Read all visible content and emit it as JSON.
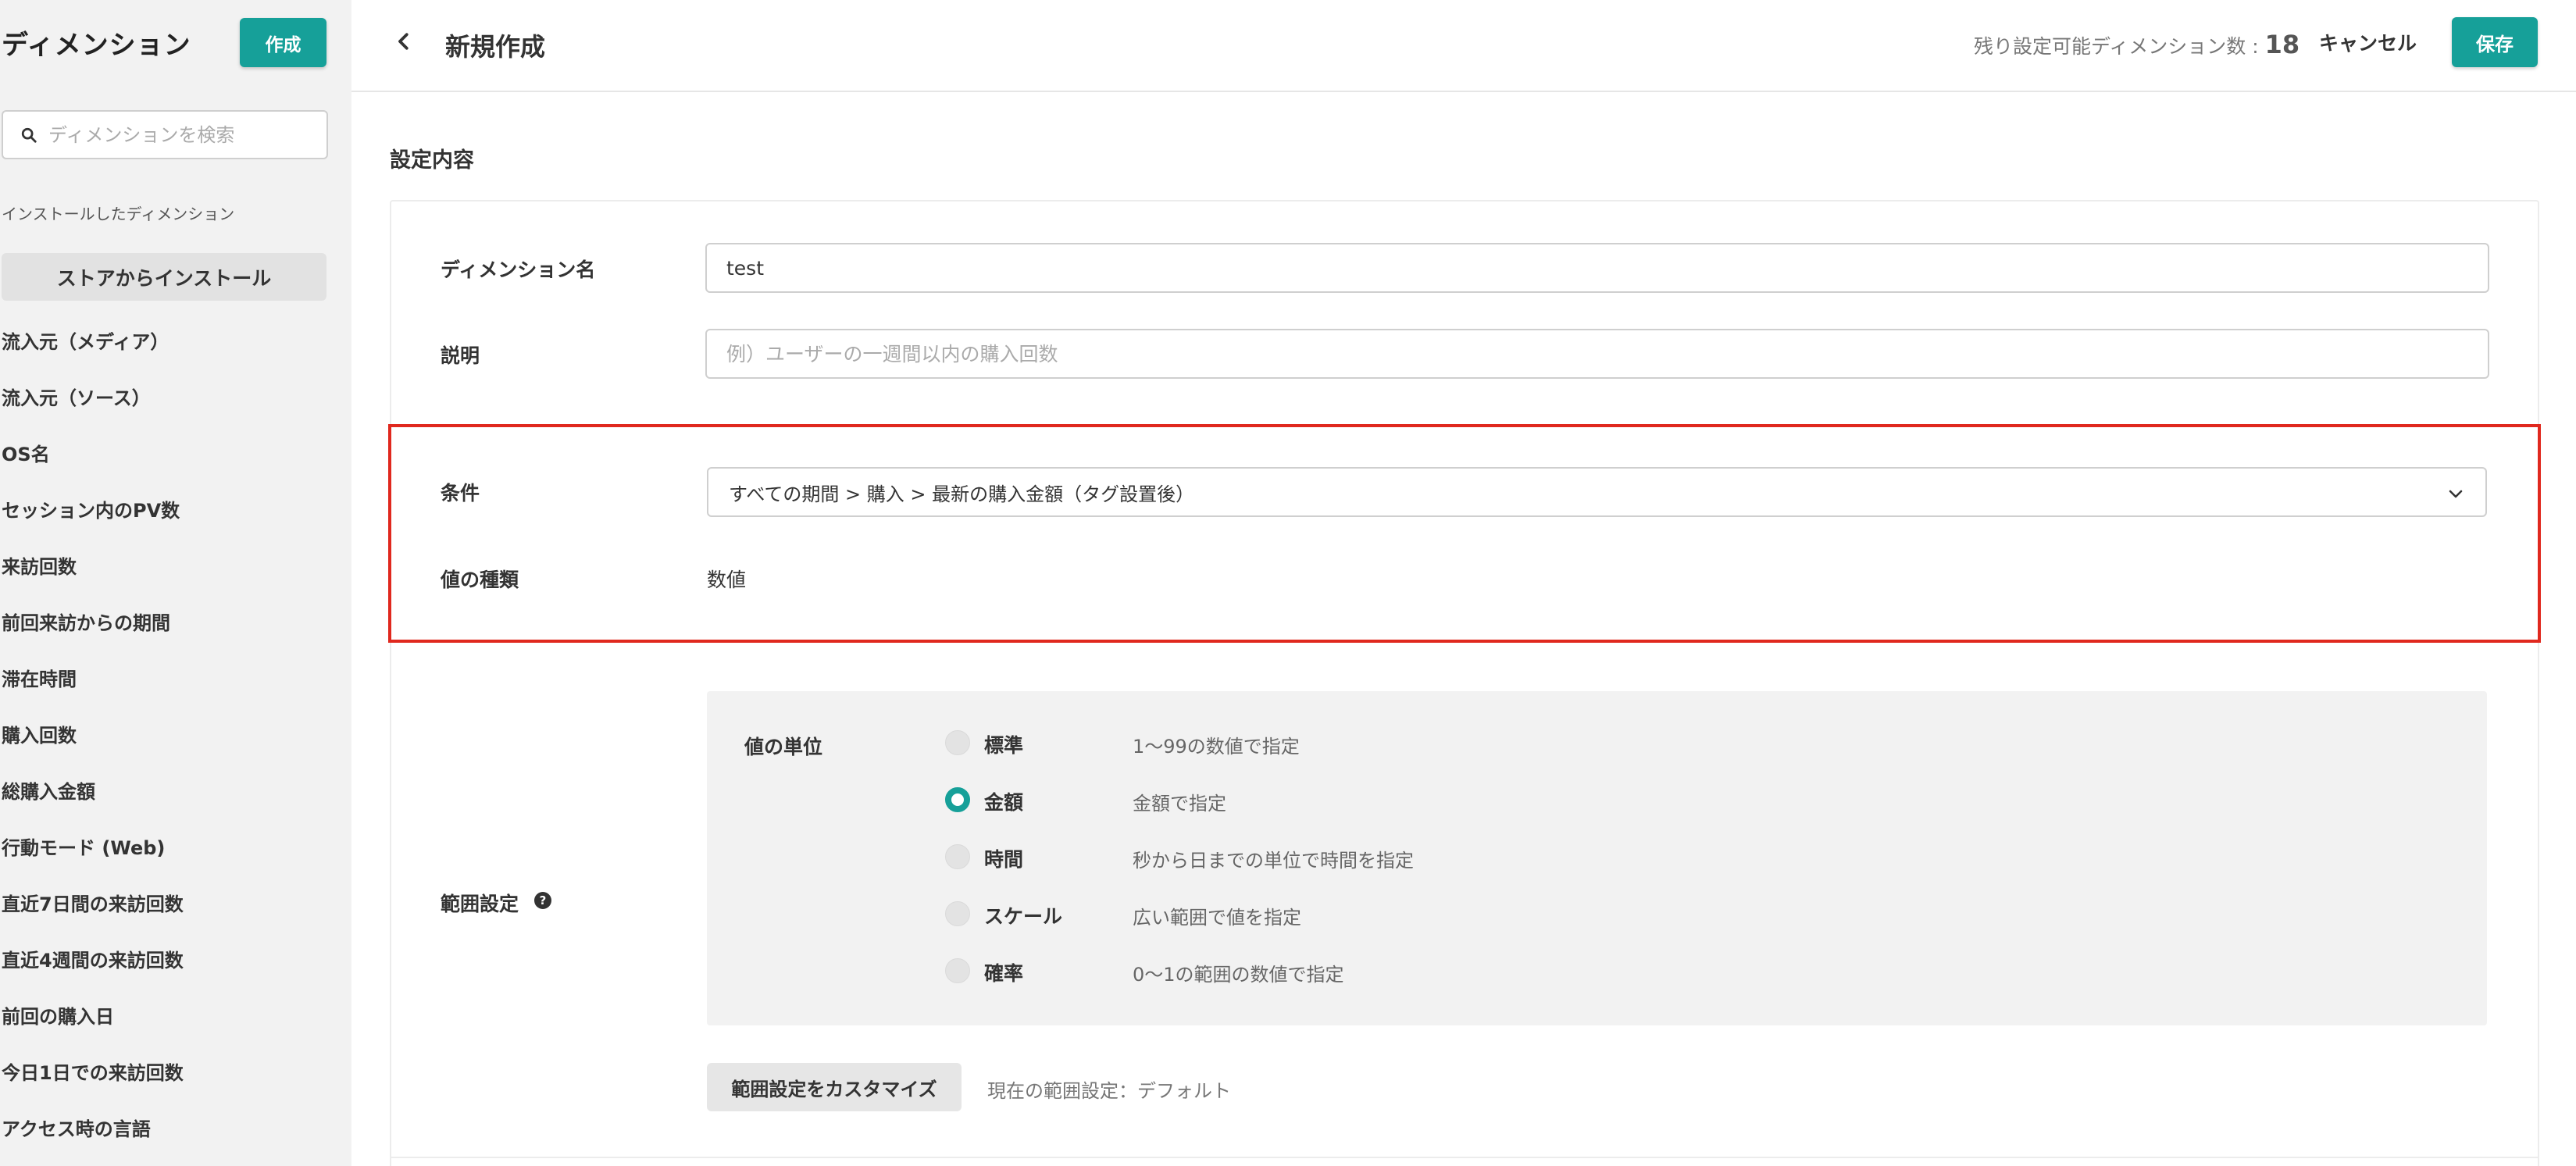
{
  "sidebar": {
    "title": "ディメンション",
    "create_label": "作成",
    "search_placeholder": "ディメンションを検索",
    "installed_label": "インストールしたディメンション",
    "store_label": "ストアからインストール",
    "items": [
      "流入元（メディア）",
      "流入元（ソース）",
      "OS名",
      "セッション内のPV数",
      "来訪回数",
      "前回来訪からの期間",
      "滞在時間",
      "購入回数",
      "総購入金額",
      "行動モード (Web)",
      "直近7日間の来訪回数",
      "直近4週間の来訪回数",
      "前回の購入日",
      "今日1日での来訪回数",
      "アクセス時の言語"
    ]
  },
  "header": {
    "title": "新規作成",
    "remaining_label": "残り設定可能ディメンション数 : ",
    "remaining_count": "18",
    "cancel_label": "キャンセル",
    "save_label": "保存"
  },
  "main": {
    "section_title": "設定内容",
    "name_label": "ディメンション名",
    "name_value": "test",
    "description_label": "説明",
    "description_placeholder": "例）ユーザーの一週間以内の購入回数",
    "condition_label": "条件",
    "condition_value": "すべての期間 > 購入 > 最新の購入金額（タグ設置後）",
    "value_type_label": "値の種類",
    "value_type_value": "数値",
    "range_label": "範囲設定",
    "unit_label": "値の単位",
    "units": [
      {
        "name": "標準",
        "desc": "1〜99の数値で指定",
        "selected": false
      },
      {
        "name": "金額",
        "desc": "金額で指定",
        "selected": true
      },
      {
        "name": "時間",
        "desc": "秒から日までの単位で時間を指定",
        "selected": false
      },
      {
        "name": "スケール",
        "desc": "広い範囲で値を指定",
        "selected": false
      },
      {
        "name": "確率",
        "desc": "0〜1の範囲の数値で指定",
        "selected": false
      }
    ],
    "customize_label": "範囲設定をカスタマイズ",
    "current_range": "現在の範囲設定：デフォルト"
  },
  "colors": {
    "accent": "#16a099",
    "highlight": "#e0281e"
  }
}
